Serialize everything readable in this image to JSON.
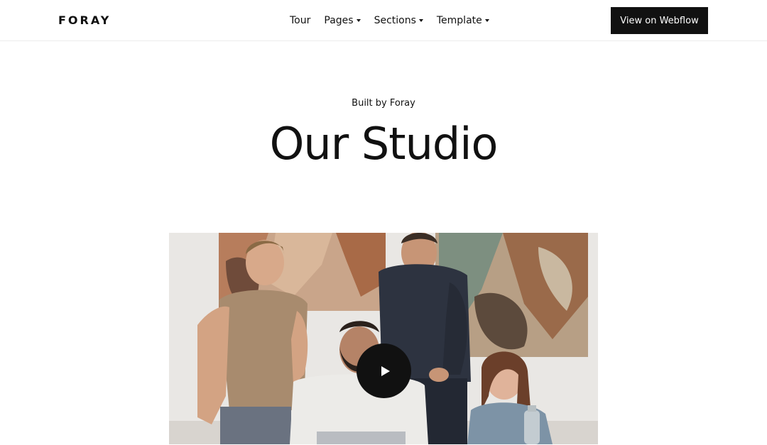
{
  "brand": {
    "logo_text": "FORAY"
  },
  "nav": {
    "items": [
      {
        "label": "Tour",
        "has_dropdown": false
      },
      {
        "label": "Pages",
        "has_dropdown": true
      },
      {
        "label": "Sections",
        "has_dropdown": true
      },
      {
        "label": "Template",
        "has_dropdown": true
      }
    ],
    "cta_label": "View on Webflow"
  },
  "hero": {
    "eyebrow": "Built by Foray",
    "title": "Our Studio"
  },
  "video": {
    "play_icon": "play-icon"
  },
  "colors": {
    "text": "#111111",
    "button_bg": "#111111",
    "button_text": "#ffffff",
    "background": "#ffffff"
  }
}
